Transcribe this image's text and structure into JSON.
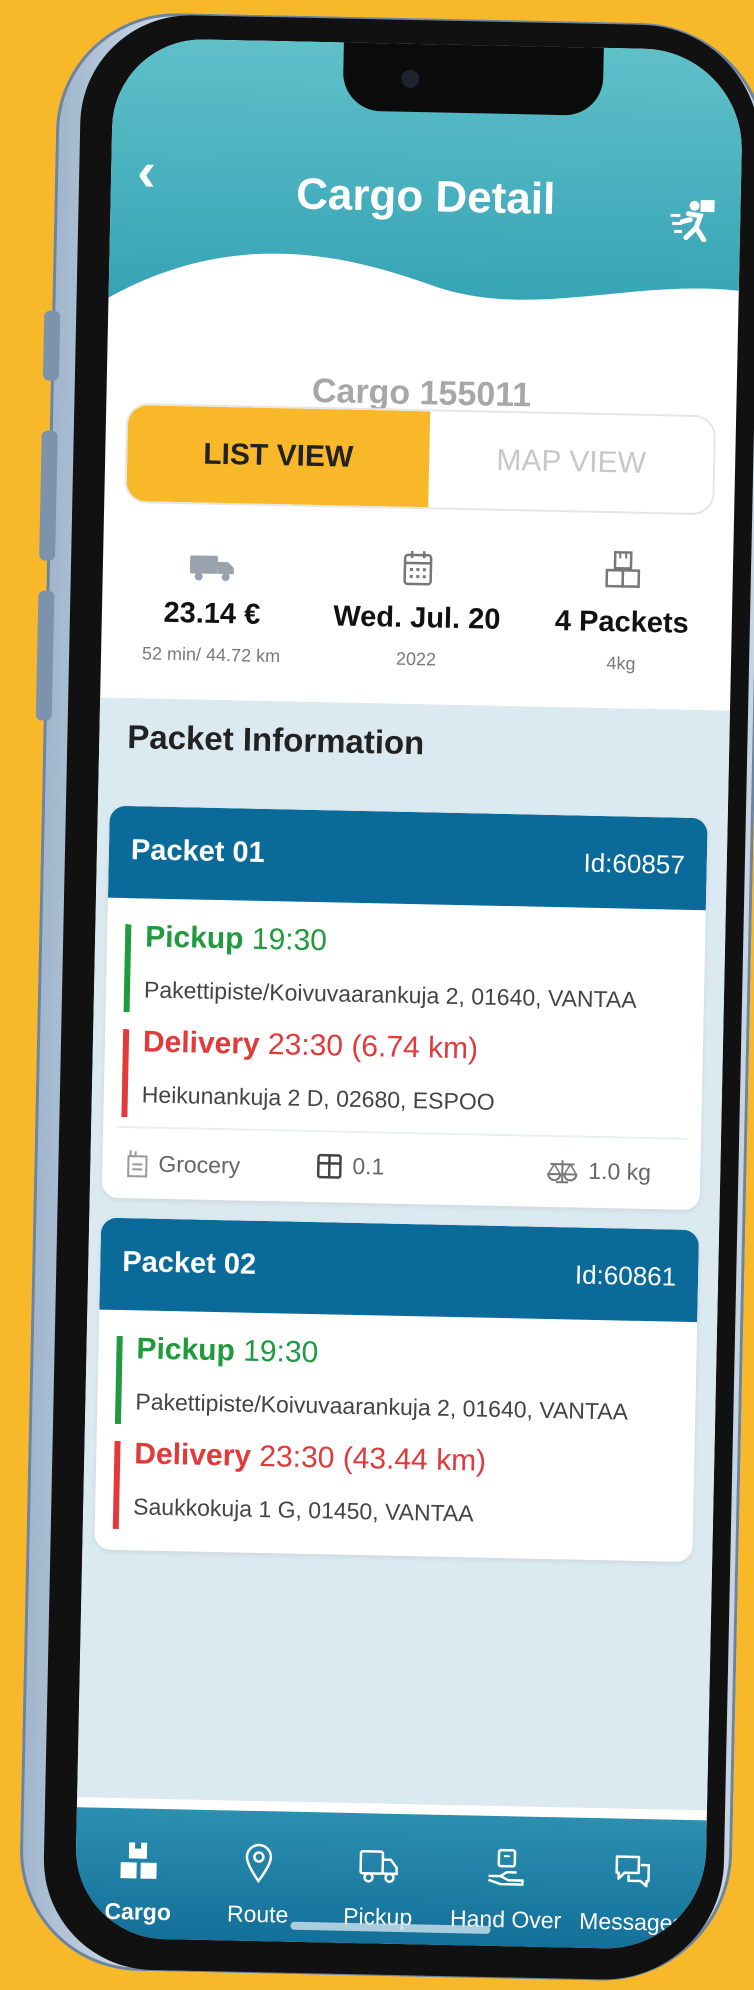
{
  "header": {
    "title": "Cargo Detail",
    "back_icon": "chevron-left-icon",
    "action_icon": "delivery-runner-icon"
  },
  "cargo": {
    "label": "Cargo  155011"
  },
  "view_toggle": {
    "list_label": "LIST VIEW",
    "map_label": "MAP VIEW",
    "selected": "LIST VIEW"
  },
  "summary": {
    "price": "23.14 €",
    "duration": "52 min/ 44.72 km",
    "date": "Wed. Jul. 20",
    "year": "2022",
    "packets": "4 Packets",
    "weight": "4kg"
  },
  "packet_section": {
    "title": "Packet Information"
  },
  "packets": [
    {
      "name": "Packet 01",
      "id": "Id:60857",
      "pickup_label": "Pickup",
      "pickup_time": "19:30",
      "pickup_address": "Pakettipiste/Koivuvaarankuja 2, 01640, VANTAA",
      "delivery_label": "Delivery",
      "delivery_time": "23:30 (6.74 km)",
      "delivery_address": "Heikunankuja 2 D, 02680, ESPOO",
      "category": "Grocery",
      "volume": "0.1",
      "weight": "1.0 kg"
    },
    {
      "name": "Packet 02",
      "id": "Id:60861",
      "pickup_label": "Pickup",
      "pickup_time": "19:30",
      "pickup_address": "Pakettipiste/Koivuvaarankuja 2, 01640, VANTAA",
      "delivery_label": "Delivery",
      "delivery_time": "23:30 (43.44 km)",
      "delivery_address": "Saukkokuja 1 G, 01450, VANTAA"
    }
  ],
  "tabbar": {
    "items": [
      {
        "label": "Cargo",
        "icon": "cargo-boxes-icon",
        "active": true
      },
      {
        "label": "Route",
        "icon": "location-pin-icon"
      },
      {
        "label": "Pickup",
        "icon": "truck-icon"
      },
      {
        "label": "Hand Over",
        "icon": "hand-over-icon"
      },
      {
        "label": "Messages",
        "icon": "chat-bubbles-icon"
      }
    ]
  },
  "colors": {
    "accent": "#f8b82a",
    "header": "#2f9fb2",
    "card_header": "#0a6b9a",
    "pickup": "#1f9a3c",
    "delivery": "#e23a3a"
  }
}
